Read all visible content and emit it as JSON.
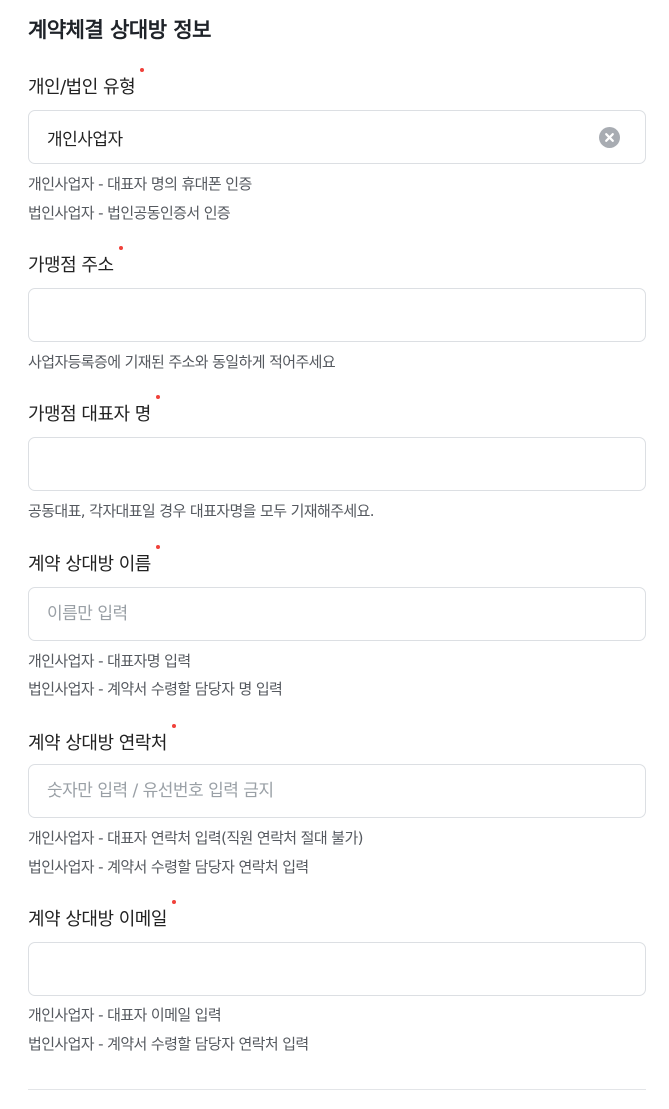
{
  "section_title": "계약체결 상대방 정보",
  "fields": [
    {
      "label": "개인/법인 유형",
      "value": "개인사업자",
      "placeholder": "",
      "help": [
        "개인사업자 - 대표자 명의 휴대폰 인증",
        "법인사업자 - 법인공동인증서 인증"
      ]
    },
    {
      "label": "가맹점 주소",
      "value": "",
      "placeholder": "",
      "help": [
        "사업자등록증에 기재된 주소와 동일하게 적어주세요"
      ]
    },
    {
      "label": "가맹점 대표자 명",
      "value": "",
      "placeholder": "",
      "help": [
        "공동대표, 각자대표일 경우 대표자명을 모두 기재해주세요."
      ]
    },
    {
      "label": "계약 상대방 이름",
      "value": "",
      "placeholder": "이름만 입력",
      "help": [
        "개인사업자 - 대표자명 입력",
        "법인사업자 - 계약서 수령할 담당자 명 입력"
      ]
    },
    {
      "label": "계약 상대방 연락처",
      "value": "",
      "placeholder": "숫자만 입력 / 유선번호 입력 금지",
      "help": [
        "개인사업자 - 대표자 연락처 입력(직원 연락처 절대 불가)",
        "법인사업자 - 계약서 수령할 담당자 연락처 입력"
      ]
    },
    {
      "label": "계약 상대방 이메일",
      "value": "",
      "placeholder": "",
      "help": [
        "개인사업자 - 대표자 이메일 입력",
        "법인사업자 - 계약서 수령할 담당자 연락처 입력"
      ]
    }
  ],
  "icons": {
    "clear": "clear-circle-icon",
    "required": "required-dot"
  },
  "colors": {
    "required_dot": "#f0413b",
    "clear_icon_bg": "#a8acb2",
    "border": "#dcdfe3",
    "placeholder": "#9aa0a6"
  }
}
